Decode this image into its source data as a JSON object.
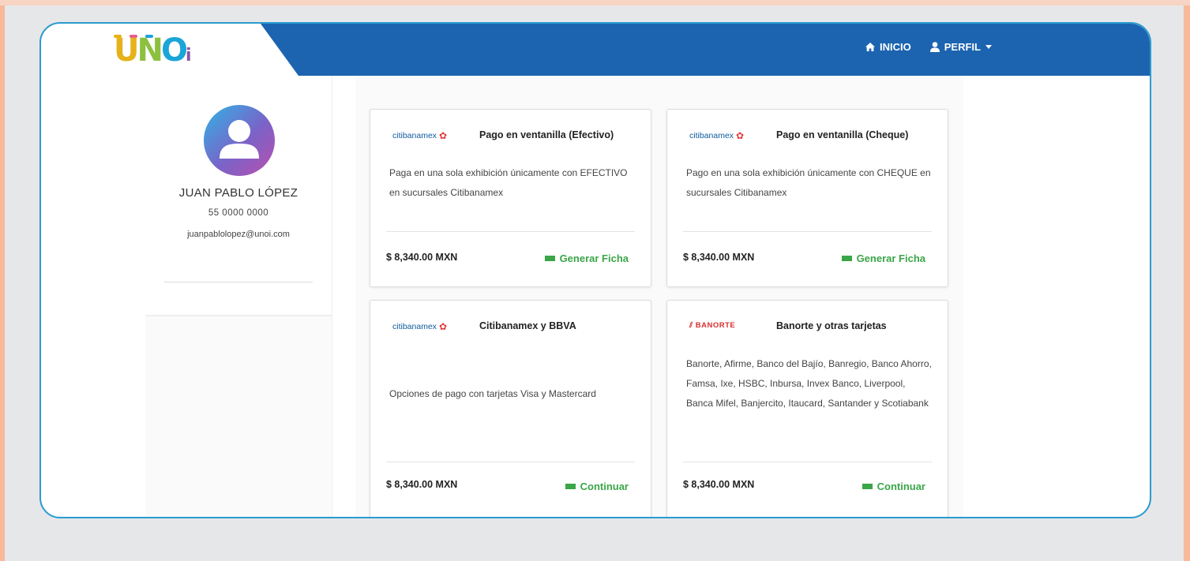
{
  "logo": {
    "text_parts": [
      "U",
      "N",
      "O",
      "i"
    ]
  },
  "nav": {
    "inicio_label": "INICIO",
    "perfil_label": "PERFIL",
    "home_icon": "home-icon",
    "user_icon": "user-icon",
    "caret_icon": "caret-down-icon"
  },
  "profile": {
    "name": "JUAN PABLO LÓPEZ",
    "phone": "55 0000 0000",
    "email": "juanpablolopez@unoi.com"
  },
  "cards": [
    {
      "bank": "citibanamex",
      "title": "Pago en ventanilla (Efectivo)",
      "description": "Paga en una sola exhibición únicamente con EFECTIVO en sucursales Citibanamex",
      "price": "$ 8,340.00 MXN",
      "action": "Generar Ficha"
    },
    {
      "bank": "citibanamex",
      "title": "Pago en ventanilla (Cheque)",
      "description": "Pago en una sola exhibición únicamente con CHEQUE en sucursales Citibanamex",
      "price": "$ 8,340.00 MXN",
      "action": "Generar Ficha"
    },
    {
      "bank": "citibanamex",
      "title": "Citibanamex y BBVA",
      "description": "Opciones de pago con tarjetas Visa y Mastercard",
      "price": "$ 8,340.00 MXN",
      "action": "Continuar"
    },
    {
      "bank": "BANORTE",
      "title": "Banorte y otras tarjetas",
      "description": "Banorte, Afirme, Banco del Bajío, Banregio, Banco Ahorro, Famsa, Ixe, HSBC, Inbursa, Invex Banco, Liverpool, Banca Mifel, Banjercito, Itaucard, Santander y Scotiabank",
      "price": "$ 8,340.00 MXN",
      "action": "Continuar"
    }
  ],
  "colors": {
    "navbar": "#1c64b0",
    "frame_border": "#2a9bd0",
    "action_green": "#3aa648",
    "citibanamex_blue": "#0d5a9e",
    "banorte_red": "#d92e2e"
  }
}
